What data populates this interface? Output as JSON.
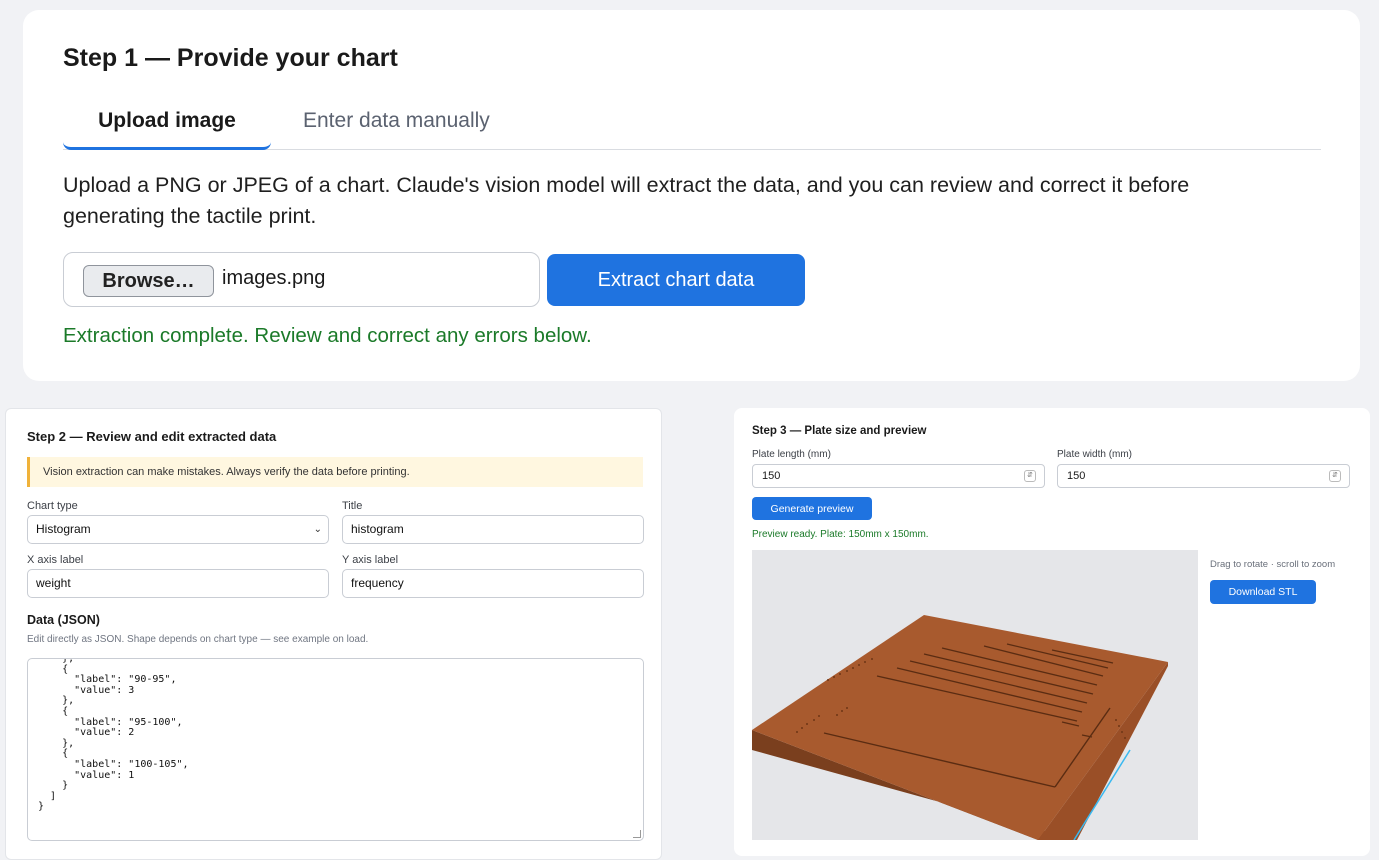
{
  "step1": {
    "title": "Step 1 — Provide your chart",
    "tabs": [
      {
        "label": "Upload image",
        "active": true
      },
      {
        "label": "Enter data manually",
        "active": false
      }
    ],
    "description": "Upload a PNG or JPEG of a chart. Claude's vision model will extract the data, and you can review and correct it before generating the tactile print.",
    "browse_label": "Browse…",
    "file_name": "images.png",
    "extract_label": "Extract chart data",
    "status": "Extraction complete. Review and correct any errors below."
  },
  "step2": {
    "title": "Step 2 — Review and edit extracted data",
    "warning": "Vision extraction can make mistakes. Always verify the data before printing.",
    "chart_type_label": "Chart type",
    "chart_type_value": "Histogram",
    "title_label": "Title",
    "title_value": "histogram",
    "x_label": "X axis label",
    "x_value": "weight",
    "y_label": "Y axis label",
    "y_value": "frequency",
    "data_heading": "Data (JSON)",
    "data_hint": "Edit directly as JSON. Shape depends on chart type — see example on load.",
    "json_text": "    },\n    {\n      \"label\": \"90-95\",\n      \"value\": 3\n    },\n    {\n      \"label\": \"95-100\",\n      \"value\": 2\n    },\n    {\n      \"label\": \"100-105\",\n      \"value\": 1\n    }\n  ]\n}"
  },
  "step3": {
    "title": "Step 3 — Plate size and preview",
    "length_label": "Plate length (mm)",
    "length_value": "150",
    "width_label": "Plate width (mm)",
    "width_value": "150",
    "generate_label": "Generate preview",
    "status": "Preview ready. Plate: 150mm x 150mm.",
    "viewport_hint": "Drag to rotate · scroll to zoom",
    "download_label": "Download STL"
  },
  "colors": {
    "accent": "#1f73e0",
    "success": "#1b7a29",
    "plate": "#a85a2e",
    "plate_edge": "#8c4a25",
    "warning_bg": "#fff7e0",
    "warning_border": "#f0b23a"
  }
}
